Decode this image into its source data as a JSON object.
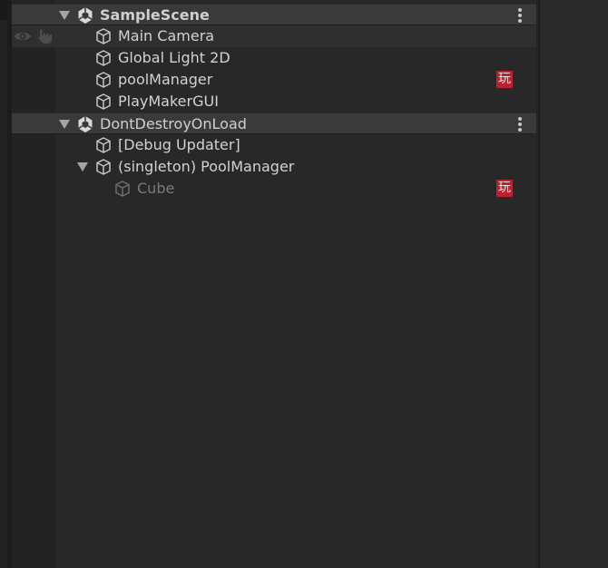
{
  "hierarchy": {
    "scenes": [
      {
        "name": "SampleScene",
        "children": [
          {
            "name": "Main Camera"
          },
          {
            "name": "Global Light 2D"
          },
          {
            "name": "poolManager",
            "badge": "玩"
          },
          {
            "name": "PlayMakerGUI"
          }
        ]
      },
      {
        "name": "DontDestroyOnLoad",
        "children": [
          {
            "name": "[Debug Updater]"
          },
          {
            "name": "(singleton) PoolManager",
            "children": [
              {
                "name": "Cube",
                "badge": "玩",
                "inactive": true
              }
            ]
          }
        ]
      }
    ]
  },
  "colors": {
    "panel_bg": "#282828",
    "scene_header_bg": "#3a3a3a",
    "badge_bg": "#b8232e",
    "text": "#d2d2d2",
    "inactive_text": "#7a7a7a"
  },
  "icons": {
    "scene": "unity-scene-icon",
    "gameobject": "cube-icon",
    "visibility": "eye-icon",
    "pickable": "hand-icon",
    "menu": "kebab-menu-icon",
    "playmaker": "playmaker-fsm-icon"
  }
}
